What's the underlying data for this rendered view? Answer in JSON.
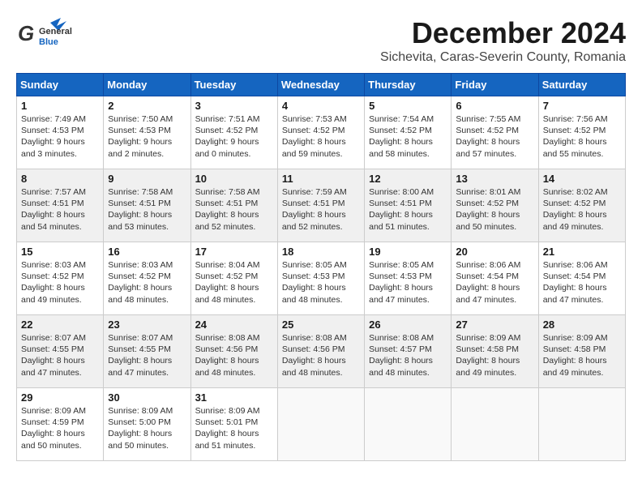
{
  "header": {
    "logo": {
      "general": "General",
      "blue": "Blue"
    },
    "month": "December 2024",
    "location": "Sichevita, Caras-Severin County, Romania"
  },
  "weekdays": [
    "Sunday",
    "Monday",
    "Tuesday",
    "Wednesday",
    "Thursday",
    "Friday",
    "Saturday"
  ],
  "weeks": [
    [
      {
        "day": "1",
        "sunrise": "Sunrise: 7:49 AM",
        "sunset": "Sunset: 4:53 PM",
        "daylight": "Daylight: 9 hours and 3 minutes."
      },
      {
        "day": "2",
        "sunrise": "Sunrise: 7:50 AM",
        "sunset": "Sunset: 4:53 PM",
        "daylight": "Daylight: 9 hours and 2 minutes."
      },
      {
        "day": "3",
        "sunrise": "Sunrise: 7:51 AM",
        "sunset": "Sunset: 4:52 PM",
        "daylight": "Daylight: 9 hours and 0 minutes."
      },
      {
        "day": "4",
        "sunrise": "Sunrise: 7:53 AM",
        "sunset": "Sunset: 4:52 PM",
        "daylight": "Daylight: 8 hours and 59 minutes."
      },
      {
        "day": "5",
        "sunrise": "Sunrise: 7:54 AM",
        "sunset": "Sunset: 4:52 PM",
        "daylight": "Daylight: 8 hours and 58 minutes."
      },
      {
        "day": "6",
        "sunrise": "Sunrise: 7:55 AM",
        "sunset": "Sunset: 4:52 PM",
        "daylight": "Daylight: 8 hours and 57 minutes."
      },
      {
        "day": "7",
        "sunrise": "Sunrise: 7:56 AM",
        "sunset": "Sunset: 4:52 PM",
        "daylight": "Daylight: 8 hours and 55 minutes."
      }
    ],
    [
      {
        "day": "8",
        "sunrise": "Sunrise: 7:57 AM",
        "sunset": "Sunset: 4:51 PM",
        "daylight": "Daylight: 8 hours and 54 minutes."
      },
      {
        "day": "9",
        "sunrise": "Sunrise: 7:58 AM",
        "sunset": "Sunset: 4:51 PM",
        "daylight": "Daylight: 8 hours and 53 minutes."
      },
      {
        "day": "10",
        "sunrise": "Sunrise: 7:58 AM",
        "sunset": "Sunset: 4:51 PM",
        "daylight": "Daylight: 8 hours and 52 minutes."
      },
      {
        "day": "11",
        "sunrise": "Sunrise: 7:59 AM",
        "sunset": "Sunset: 4:51 PM",
        "daylight": "Daylight: 8 hours and 52 minutes."
      },
      {
        "day": "12",
        "sunrise": "Sunrise: 8:00 AM",
        "sunset": "Sunset: 4:51 PM",
        "daylight": "Daylight: 8 hours and 51 minutes."
      },
      {
        "day": "13",
        "sunrise": "Sunrise: 8:01 AM",
        "sunset": "Sunset: 4:52 PM",
        "daylight": "Daylight: 8 hours and 50 minutes."
      },
      {
        "day": "14",
        "sunrise": "Sunrise: 8:02 AM",
        "sunset": "Sunset: 4:52 PM",
        "daylight": "Daylight: 8 hours and 49 minutes."
      }
    ],
    [
      {
        "day": "15",
        "sunrise": "Sunrise: 8:03 AM",
        "sunset": "Sunset: 4:52 PM",
        "daylight": "Daylight: 8 hours and 49 minutes."
      },
      {
        "day": "16",
        "sunrise": "Sunrise: 8:03 AM",
        "sunset": "Sunset: 4:52 PM",
        "daylight": "Daylight: 8 hours and 48 minutes."
      },
      {
        "day": "17",
        "sunrise": "Sunrise: 8:04 AM",
        "sunset": "Sunset: 4:52 PM",
        "daylight": "Daylight: 8 hours and 48 minutes."
      },
      {
        "day": "18",
        "sunrise": "Sunrise: 8:05 AM",
        "sunset": "Sunset: 4:53 PM",
        "daylight": "Daylight: 8 hours and 48 minutes."
      },
      {
        "day": "19",
        "sunrise": "Sunrise: 8:05 AM",
        "sunset": "Sunset: 4:53 PM",
        "daylight": "Daylight: 8 hours and 47 minutes."
      },
      {
        "day": "20",
        "sunrise": "Sunrise: 8:06 AM",
        "sunset": "Sunset: 4:54 PM",
        "daylight": "Daylight: 8 hours and 47 minutes."
      },
      {
        "day": "21",
        "sunrise": "Sunrise: 8:06 AM",
        "sunset": "Sunset: 4:54 PM",
        "daylight": "Daylight: 8 hours and 47 minutes."
      }
    ],
    [
      {
        "day": "22",
        "sunrise": "Sunrise: 8:07 AM",
        "sunset": "Sunset: 4:55 PM",
        "daylight": "Daylight: 8 hours and 47 minutes."
      },
      {
        "day": "23",
        "sunrise": "Sunrise: 8:07 AM",
        "sunset": "Sunset: 4:55 PM",
        "daylight": "Daylight: 8 hours and 47 minutes."
      },
      {
        "day": "24",
        "sunrise": "Sunrise: 8:08 AM",
        "sunset": "Sunset: 4:56 PM",
        "daylight": "Daylight: 8 hours and 48 minutes."
      },
      {
        "day": "25",
        "sunrise": "Sunrise: 8:08 AM",
        "sunset": "Sunset: 4:56 PM",
        "daylight": "Daylight: 8 hours and 48 minutes."
      },
      {
        "day": "26",
        "sunrise": "Sunrise: 8:08 AM",
        "sunset": "Sunset: 4:57 PM",
        "daylight": "Daylight: 8 hours and 48 minutes."
      },
      {
        "day": "27",
        "sunrise": "Sunrise: 8:09 AM",
        "sunset": "Sunset: 4:58 PM",
        "daylight": "Daylight: 8 hours and 49 minutes."
      },
      {
        "day": "28",
        "sunrise": "Sunrise: 8:09 AM",
        "sunset": "Sunset: 4:58 PM",
        "daylight": "Daylight: 8 hours and 49 minutes."
      }
    ],
    [
      {
        "day": "29",
        "sunrise": "Sunrise: 8:09 AM",
        "sunset": "Sunset: 4:59 PM",
        "daylight": "Daylight: 8 hours and 50 minutes."
      },
      {
        "day": "30",
        "sunrise": "Sunrise: 8:09 AM",
        "sunset": "Sunset: 5:00 PM",
        "daylight": "Daylight: 8 hours and 50 minutes."
      },
      {
        "day": "31",
        "sunrise": "Sunrise: 8:09 AM",
        "sunset": "Sunset: 5:01 PM",
        "daylight": "Daylight: 8 hours and 51 minutes."
      },
      null,
      null,
      null,
      null
    ]
  ]
}
